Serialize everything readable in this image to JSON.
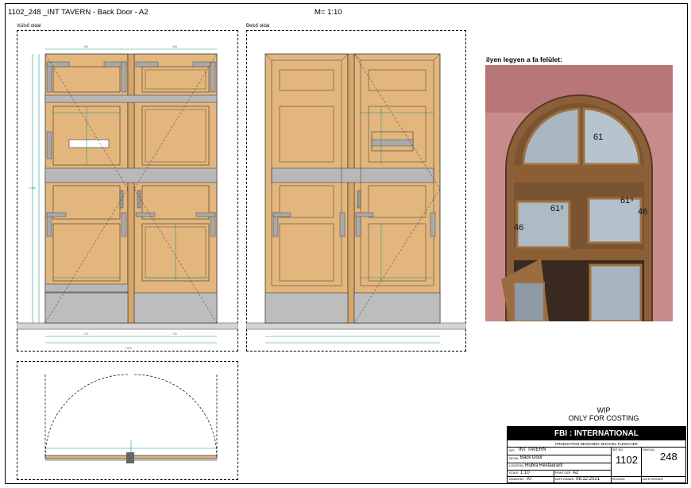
{
  "sheet": {
    "title": "1102_248 _INT TAVERN - Back Door - A2",
    "scale": "M=  1:10",
    "outer_view_label": "Külső oldal",
    "inner_view_label": "Belső oldal",
    "photo_caption": "ilyen legyen a fa felület:"
  },
  "photo_marks": [
    "61",
    "61⁵",
    "61⁵",
    "46",
    "46"
  ],
  "wip": {
    "line1": "WIP",
    "line2": "ONLY FOR COSTING"
  },
  "title_block": {
    "company": "FBI : INTERNATIONAL",
    "designer": "PRODUCTION DESIGNER: MICHAEL FLEISCHER",
    "set_label": "SET:",
    "set_value": "INT TAVERN",
    "detail_label": "DETAIL:",
    "detail_value": "Back Door",
    "location_label": "LOCATION:",
    "location_value": "Rubra Restaurant",
    "scale_label": "SCALE:",
    "scale_value": "1:10",
    "print_label": "PRINT SIZE:",
    "print_value": "A2",
    "drawn_label": "DRAWN BY:",
    "drawn_value": "AT",
    "date_label": "DATE DRAWN:",
    "date_value": "08.12.2021",
    "revised_label": "REVISED:",
    "date_revised_label": "DATE REVISED:",
    "setno_label": "SET NO:",
    "setno_value": "1102",
    "dwgno_label": "DWG NO:",
    "dwgno_value": "248"
  },
  "colors": {
    "wood": "#e3b67d",
    "grey_band": "#b8b8b8",
    "floor": "#d4d4d4",
    "dim": "#1c9a86",
    "dark_wood": "#6b4a2a",
    "wall_pink": "#c98a8c"
  }
}
